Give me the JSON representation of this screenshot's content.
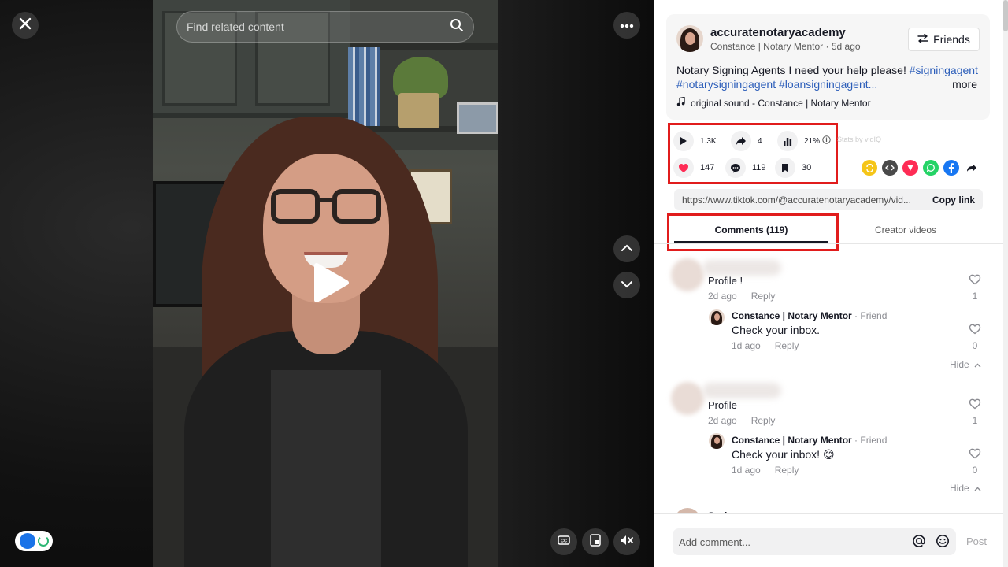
{
  "video": {
    "search_placeholder": "Find related content",
    "icons": {
      "close": "close-icon",
      "more": "more-icon",
      "play": "play-icon",
      "up": "chevron-up-icon",
      "down": "chevron-down-icon",
      "captions": "captions-icon",
      "pip": "picture-in-picture-icon",
      "mute": "volume-muted-icon"
    }
  },
  "post": {
    "username": "accuratenotaryacademy",
    "subline": "Constance | Notary Mentor · 5d ago",
    "friends_label": "Friends",
    "description_text": "Notary Signing Agents I need your help please! ",
    "tags_line1": "#signingagent",
    "tags_line2": "#notarysigningagent #loansigningagent...",
    "more_label": "more",
    "sound": "original sound - Constance | Notary Mentor"
  },
  "stats": {
    "plays": "1.3K",
    "shares": "4",
    "engagement": "21%",
    "likes": "147",
    "comments": "119",
    "saves": "30",
    "vidiq_label": "Stats by vidIQ"
  },
  "share": {
    "url": "https://www.tiktok.com/@accuratenotaryacademy/vid...",
    "copy_label": "Copy link",
    "colors": {
      "repost": "#f5c518",
      "embed": "#4a4a4a",
      "pinterest": "#fe2c55",
      "whatsapp": "#25d366",
      "facebook": "#1877f2"
    }
  },
  "tabs": {
    "comments": "Comments (119)",
    "creator": "Creator videos"
  },
  "comments": [
    {
      "text": "Profile !",
      "time": "2d ago",
      "reply_label": "Reply",
      "likes": "1",
      "reply": {
        "name": "Constance | Notary Mentor",
        "friend": " · Friend",
        "text": "Check your inbox.",
        "time": "1d ago",
        "reply_label": "Reply",
        "likes": "0"
      },
      "hide_label": "Hide"
    },
    {
      "text": "Profile",
      "time": "2d ago",
      "reply_label": "Reply",
      "likes": "1",
      "reply": {
        "name": "Constance | Notary Mentor",
        "friend": " · Friend",
        "text": "Check your inbox! 😊",
        "time": "1d ago",
        "reply_label": "Reply",
        "likes": "0"
      },
      "hide_label": "Hide"
    }
  ],
  "partial_comment_name": "Darla",
  "composer": {
    "placeholder": "Add comment...",
    "post_label": "Post"
  },
  "accent_colors": {
    "highlight_box": "#e11c1c",
    "tag": "#2b5db9",
    "like_heart": "#fe2c55"
  }
}
